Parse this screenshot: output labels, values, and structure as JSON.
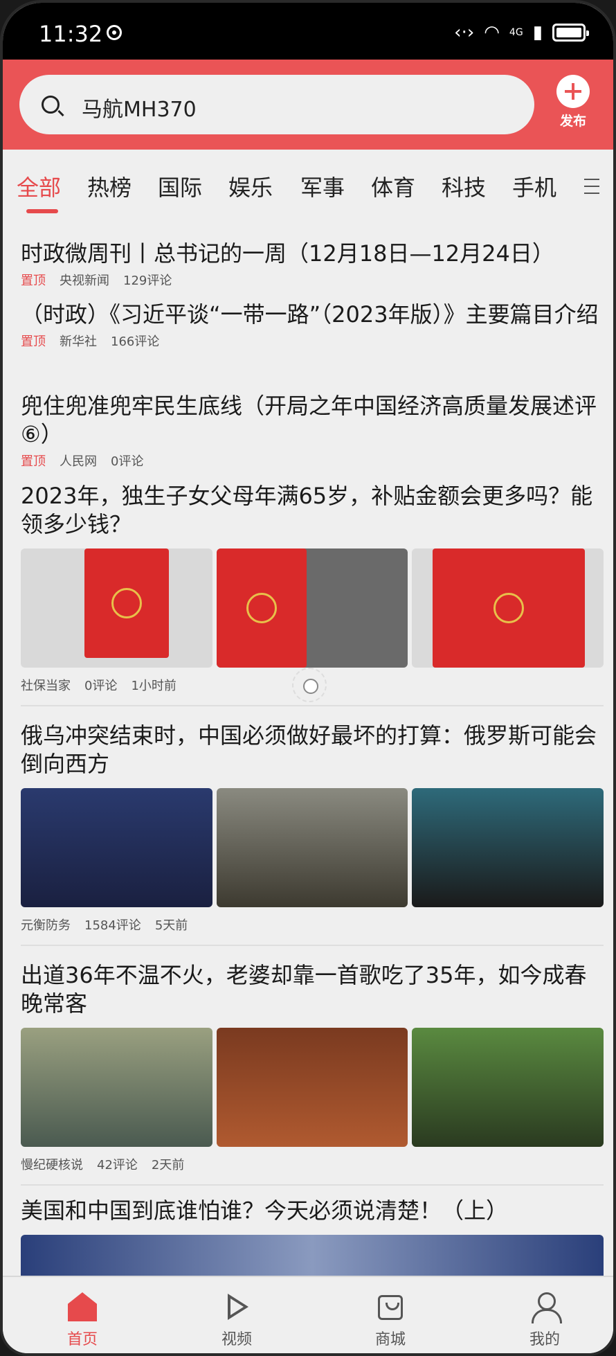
{
  "status_bar": {
    "time": "11:32",
    "network": "4G"
  },
  "search": {
    "query": "马航MH370"
  },
  "publish": {
    "label": "发布"
  },
  "tabs": [
    "全部",
    "热榜",
    "国际",
    "娱乐",
    "军事",
    "体育",
    "科技",
    "手机"
  ],
  "active_tab": "全部",
  "news": [
    {
      "title": "时政微周刊丨总书记的一周（12月18日—12月24日）",
      "tag": "置顶",
      "source": "央视新闻",
      "comments": "129评论"
    },
    {
      "title": "（时政）《习近平谈“一带一路”（2023年版）》主要篇目介绍",
      "tag": "置顶",
      "source": "新华社",
      "comments": "166评论"
    },
    {
      "title": "兜住兜准兜牢民生底线（开局之年中国经济高质量发展述评⑥）",
      "tag": "置顶",
      "source": "人民网",
      "comments": "0评论"
    },
    {
      "title": "2023年，独生子女父母年满65岁，补贴金额会更多吗？能领多少钱？",
      "source": "社保当家",
      "comments": "0评论",
      "time": "1小时前"
    },
    {
      "title": "俄乌冲突结束时，中国必须做好最坏的打算：俄罗斯可能会倒向西方",
      "source": "元衡防务",
      "comments": "1584评论",
      "time": "5天前"
    },
    {
      "title": "出道36年不温不火，老婆却靠一首歌吃了35年，如今成春晚常客",
      "source": "慢纪硬核说",
      "comments": "42评论",
      "time": "2天前"
    },
    {
      "title": "美国和中国到底谁怕谁？今天必须说清楚！（上）"
    }
  ],
  "bottom_nav": [
    {
      "label": "首页",
      "icon": "home-icon"
    },
    {
      "label": "视频",
      "icon": "video-icon"
    },
    {
      "label": "商城",
      "icon": "bag-icon"
    },
    {
      "label": "我的",
      "icon": "user-icon"
    }
  ],
  "colors": {
    "accent": "#e64a4c",
    "header": "#ea5456"
  }
}
